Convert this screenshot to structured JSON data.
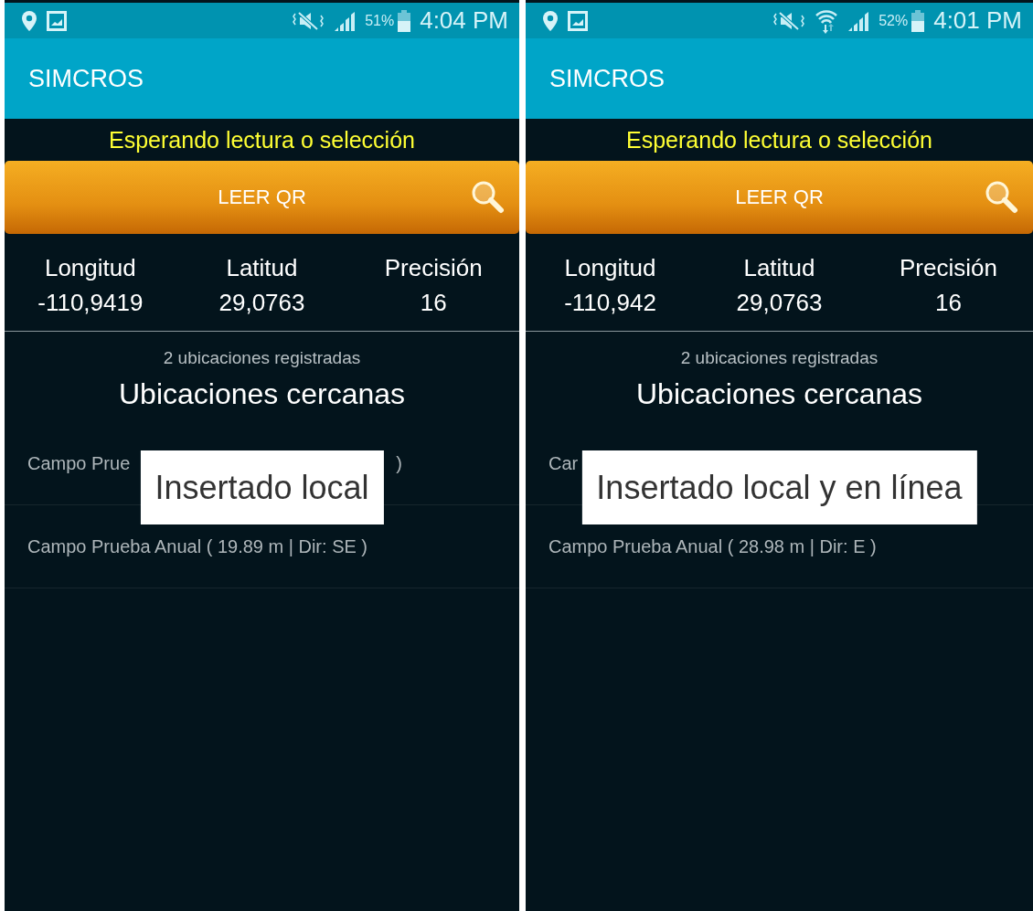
{
  "screens": [
    {
      "status_bar": {
        "time": "4:04 PM",
        "battery": "51%",
        "wifi": false
      },
      "app_title": "SIMCROS",
      "status_message": "Esperando lectura o selección",
      "scan_button": "LEER QR",
      "coordinates": [
        {
          "label": "Longitud",
          "value": "-110,9419"
        },
        {
          "label": "Latitud",
          "value": "29,0763"
        },
        {
          "label": "Precisión",
          "value": "16"
        }
      ],
      "count_text": "2 ubicaciones registradas",
      "section_title": "Ubicaciones cercanas",
      "locations": [
        {
          "text": "Campo Prue",
          "tail": ")"
        },
        {
          "text": "Campo Prueba Anual ( 19.89 m | Dir: SE )"
        }
      ],
      "toast": "Insertado local"
    },
    {
      "status_bar": {
        "time": "4:01 PM",
        "battery": "52%",
        "wifi": true
      },
      "app_title": "SIMCROS",
      "status_message": "Esperando lectura o selección",
      "scan_button": "LEER QR",
      "coordinates": [
        {
          "label": "Longitud",
          "value": "-110,942"
        },
        {
          "label": "Latitud",
          "value": "29,0763"
        },
        {
          "label": "Precisión",
          "value": "16"
        }
      ],
      "count_text": "2 ubicaciones registradas",
      "section_title": "Ubicaciones cercanas",
      "locations": [
        {
          "text": "Car"
        },
        {
          "text": "Campo Prueba Anual ( 28.98 m | Dir: E )"
        }
      ],
      "toast": "Insertado local y en línea"
    }
  ]
}
